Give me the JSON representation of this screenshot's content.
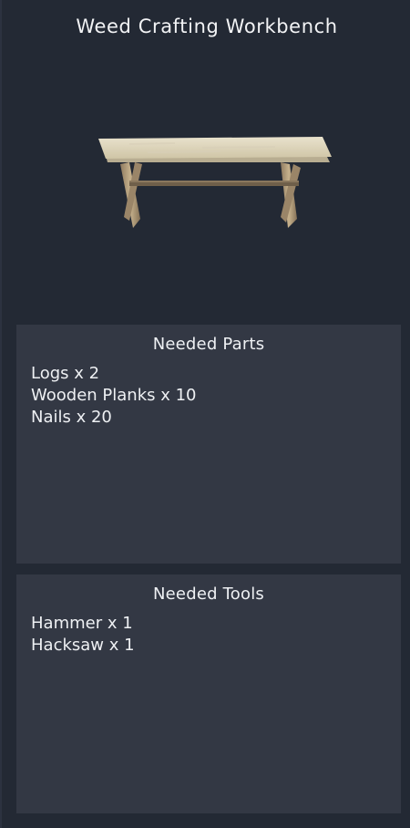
{
  "title": "Weed Crafting Workbench",
  "preview": {
    "image": "wooden-workbench"
  },
  "parts": {
    "header": "Needed Parts",
    "items": [
      "Logs x 2",
      "Wooden Planks x 10",
      "Nails x 20"
    ]
  },
  "tools": {
    "header": "Needed Tools",
    "items": [
      "Hammer x 1",
      "Hacksaw x 1"
    ]
  },
  "colors": {
    "background": "#232934",
    "box": "#333844",
    "text": "#eef0f3"
  }
}
